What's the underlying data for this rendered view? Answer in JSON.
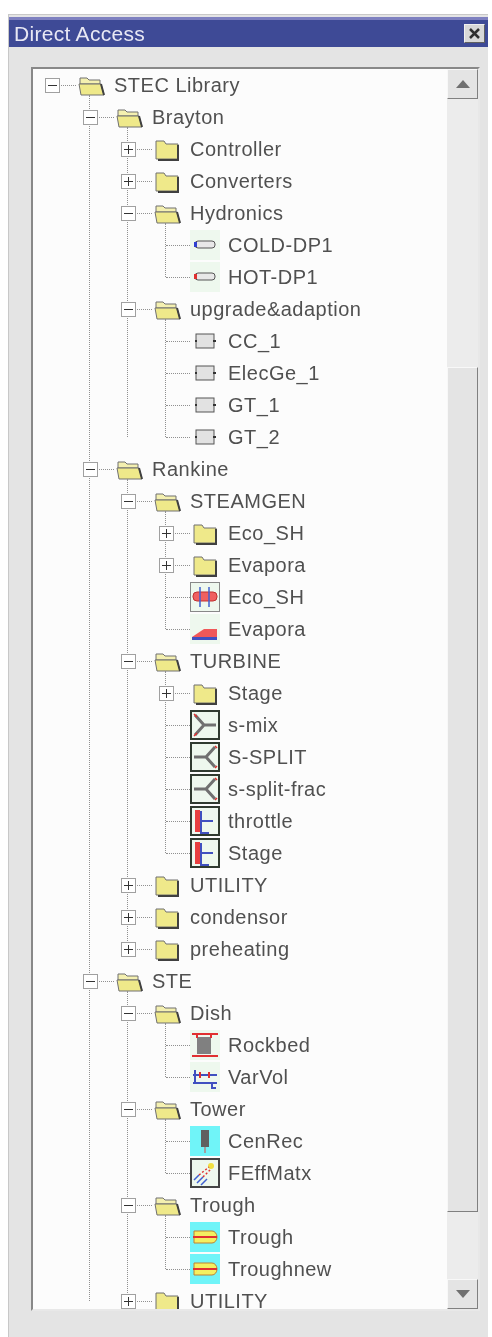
{
  "window": {
    "title": "Direct Access"
  },
  "tree": [
    {
      "label": "STEC Library",
      "kind": "folder",
      "expanded": true,
      "children": [
        {
          "label": "Brayton",
          "kind": "folder",
          "expanded": true,
          "children": [
            {
              "label": "Controller",
              "kind": "folder",
              "expanded": false
            },
            {
              "label": "Converters",
              "kind": "folder",
              "expanded": false
            },
            {
              "label": "Hydronics",
              "kind": "folder",
              "expanded": true,
              "children": [
                {
                  "label": "COLD-DP1",
                  "kind": "port-cold"
                },
                {
                  "label": "HOT-DP1",
                  "kind": "port-hot"
                }
              ]
            },
            {
              "label": "upgrade&adaption",
              "kind": "folder",
              "expanded": true,
              "children": [
                {
                  "label": "CC_1",
                  "kind": "block"
                },
                {
                  "label": "ElecGe_1",
                  "kind": "block"
                },
                {
                  "label": "GT_1",
                  "kind": "block"
                },
                {
                  "label": "GT_2",
                  "kind": "block"
                }
              ]
            }
          ]
        },
        {
          "label": "Rankine",
          "kind": "folder",
          "expanded": true,
          "children": [
            {
              "label": "STEAMGEN",
              "kind": "folder",
              "expanded": true,
              "children": [
                {
                  "label": "Eco_SH",
                  "kind": "folder",
                  "expanded": false
                },
                {
                  "label": "Evapora",
                  "kind": "folder",
                  "expanded": false
                },
                {
                  "label": "Eco_SH",
                  "kind": "heatex"
                },
                {
                  "label": "Evapora",
                  "kind": "evaporator"
                }
              ]
            },
            {
              "label": "TURBINE",
              "kind": "folder",
              "expanded": true,
              "children": [
                {
                  "label": "Stage",
                  "kind": "folder",
                  "expanded": false
                },
                {
                  "label": "s-mix",
                  "kind": "mixer"
                },
                {
                  "label": "S-SPLIT",
                  "kind": "splitter"
                },
                {
                  "label": "s-split-frac",
                  "kind": "splitter"
                },
                {
                  "label": "throttle",
                  "kind": "stage"
                },
                {
                  "label": "Stage",
                  "kind": "stage"
                }
              ]
            },
            {
              "label": "UTILITY",
              "kind": "folder",
              "expanded": false
            },
            {
              "label": "condensor",
              "kind": "folder",
              "expanded": false
            },
            {
              "label": "preheating",
              "kind": "folder",
              "expanded": false
            }
          ]
        },
        {
          "label": "STE",
          "kind": "folder",
          "expanded": true,
          "children": [
            {
              "label": "Dish",
              "kind": "folder",
              "expanded": true,
              "children": [
                {
                  "label": "Rockbed",
                  "kind": "rockbed"
                },
                {
                  "label": "VarVol",
                  "kind": "varvol"
                }
              ]
            },
            {
              "label": "Tower",
              "kind": "folder",
              "expanded": true,
              "children": [
                {
                  "label": "CenRec",
                  "kind": "receiver"
                },
                {
                  "label": "FEffMatx",
                  "kind": "field"
                }
              ]
            },
            {
              "label": "Trough",
              "kind": "folder",
              "expanded": true,
              "children": [
                {
                  "label": "Trough",
                  "kind": "trough"
                },
                {
                  "label": "Troughnew",
                  "kind": "trough"
                }
              ]
            },
            {
              "label": "UTILITY",
              "kind": "folder",
              "expanded": false
            }
          ]
        }
      ]
    }
  ]
}
